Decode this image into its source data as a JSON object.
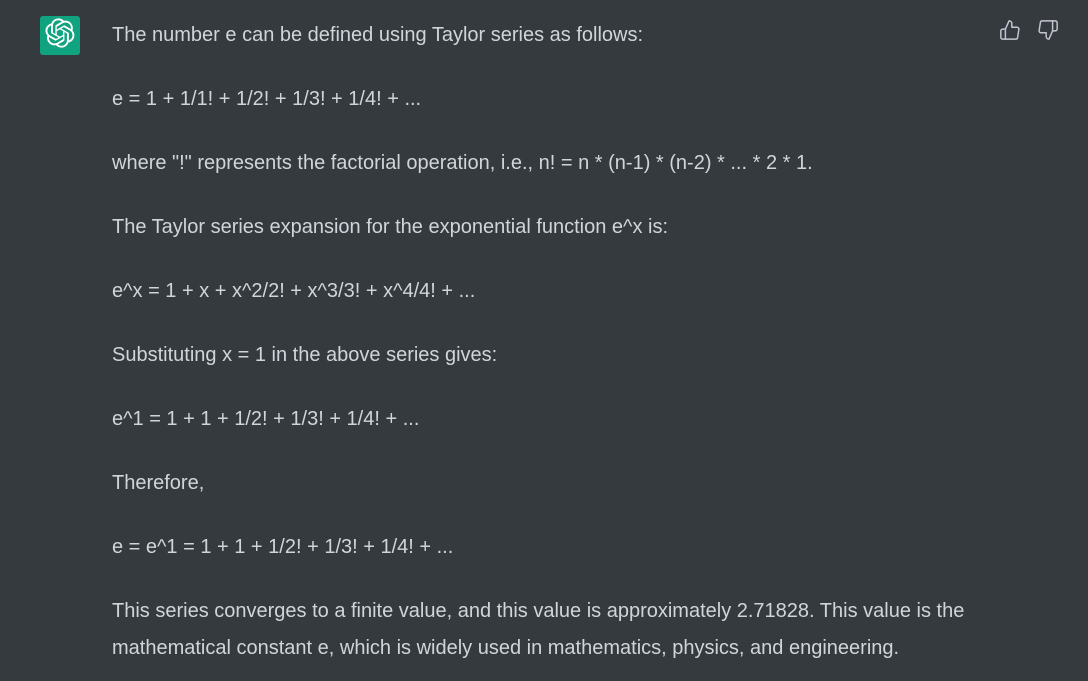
{
  "assistant": {
    "avatar_icon": "openai-logo-icon",
    "avatar_color": "#10a37f"
  },
  "feedback": {
    "thumbs_up_icon": "thumbs-up-icon",
    "thumbs_down_icon": "thumbs-down-icon"
  },
  "message": {
    "paragraphs": [
      "The number e can be defined using Taylor series as follows:",
      "e = 1 + 1/1! + 1/2! + 1/3! + 1/4! + ...",
      "where \"!\" represents the factorial operation, i.e., n! = n * (n-1) * (n-2) * ... * 2 * 1.",
      "The Taylor series expansion for the exponential function e^x is:",
      "e^x = 1 + x + x^2/2! + x^3/3! + x^4/4! + ...",
      "Substituting x = 1 in the above series gives:",
      "e^1 = 1 + 1 + 1/2! + 1/3! + 1/4! + ...",
      "Therefore,",
      "e = e^1 = 1 + 1 + 1/2! + 1/3! + 1/4! + ...",
      "This series converges to a finite value, and this value is approximately 2.71828. This value is the mathematical constant e, which is widely used in mathematics, physics, and engineering."
    ]
  },
  "colors": {
    "background": "#353a3f",
    "text": "#d1d5db",
    "icon": "#c5c5d2"
  }
}
